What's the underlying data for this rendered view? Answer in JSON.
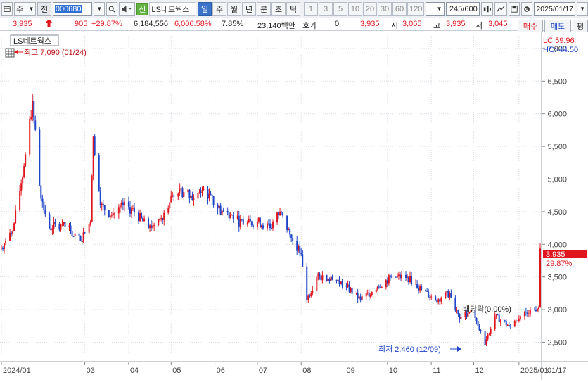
{
  "toolbar": {
    "market": "주",
    "scope": "전",
    "stock_code": "000680",
    "new_badge": "신",
    "stock_name": "LS네트웍스",
    "periods": [
      "일",
      "주",
      "월",
      "년",
      "분",
      "초",
      "틱"
    ],
    "active_period": "일",
    "numbers": [
      "1",
      "3",
      "5",
      "10",
      "20",
      "30",
      "60",
      "120"
    ],
    "count": "245/600",
    "date": "2025/01/17"
  },
  "info": {
    "price": "3,935",
    "change": "905",
    "change_pct": "+29.87%",
    "volume": "6,184,556",
    "volume_pct": "6,006.58%",
    "turnover": "7.85%",
    "amount": "23,140백만",
    "quote_label": "호가",
    "quote_value": "0",
    "quote_price": "3,935",
    "open_label": "시",
    "open": "3,065",
    "high_label": "고",
    "high": "3,935",
    "low_label": "저",
    "low": "3,045",
    "buy_label": "매수",
    "sell_label": "매도",
    "avg_label": "평"
  },
  "chart": {
    "legend_name": "LS네트웍스",
    "high_annotation": "최고 7,090 (01/24)",
    "low_annotation": "최저 2,460 (12/09)",
    "dividend_annotation": "배당락(0.00%)",
    "lc_label": "LC:59.96",
    "hc_label": "HC:-44.50",
    "current_price_tag": "3,935",
    "current_pct_tag": "29.87%",
    "y_ticks": [
      "7,000",
      "6,500",
      "6,000",
      "5,500",
      "5,000",
      "4,500",
      "4,000",
      "3,500",
      "3,000",
      "2,500"
    ],
    "x_ticks": [
      "2024/01",
      "03",
      "04",
      "05",
      "06",
      "07",
      "08",
      "09",
      "10",
      "11",
      "12",
      "2025/01"
    ],
    "x_right_label": "01/17",
    "colors": {
      "up": "#e0161f",
      "down": "#1e45c8",
      "grid": "#d9dde3",
      "tag_bg": "#e0161f"
    }
  },
  "chart_data": {
    "type": "candlestick",
    "y_range": [
      2300,
      7150
    ],
    "x_range": [
      "2024/01/02",
      "2025/01/17"
    ],
    "series": [
      {
        "name": "LS네트웍스",
        "points": [
          {
            "d": "2024/01/02",
            "c": 3950
          },
          {
            "d": "2024/01/10",
            "c": 4200
          },
          {
            "d": "2024/01/18",
            "c": 5200
          },
          {
            "d": "2024/01/24",
            "c": 6200
          },
          {
            "d": "2024/01/30",
            "c": 4700
          },
          {
            "d": "2024/02/05",
            "c": 4250
          },
          {
            "d": "2024/02/13",
            "c": 4300
          },
          {
            "d": "2024/02/20",
            "c": 4200
          },
          {
            "d": "2024/02/27",
            "c": 4050
          },
          {
            "d": "2024/03/05",
            "c": 4350
          },
          {
            "d": "2024/03/07",
            "c": 5650
          },
          {
            "d": "2024/03/12",
            "c": 4600
          },
          {
            "d": "2024/03/20",
            "c": 4450
          },
          {
            "d": "2024/03/28",
            "c": 4600
          },
          {
            "d": "2024/04/05",
            "c": 4500
          },
          {
            "d": "2024/04/15",
            "c": 4250
          },
          {
            "d": "2024/04/24",
            "c": 4400
          },
          {
            "d": "2024/05/02",
            "c": 4750
          },
          {
            "d": "2024/05/10",
            "c": 4800
          },
          {
            "d": "2024/05/17",
            "c": 4700
          },
          {
            "d": "2024/05/24",
            "c": 4850
          },
          {
            "d": "2024/06/03",
            "c": 4550
          },
          {
            "d": "2024/06/12",
            "c": 4450
          },
          {
            "d": "2024/06/21",
            "c": 4300
          },
          {
            "d": "2024/07/01",
            "c": 4350
          },
          {
            "d": "2024/07/10",
            "c": 4250
          },
          {
            "d": "2024/07/17",
            "c": 4500
          },
          {
            "d": "2024/07/25",
            "c": 4100
          },
          {
            "d": "2024/08/01",
            "c": 3850
          },
          {
            "d": "2024/08/05",
            "c": 3150
          },
          {
            "d": "2024/08/12",
            "c": 3500
          },
          {
            "d": "2024/08/22",
            "c": 3500
          },
          {
            "d": "2024/09/02",
            "c": 3350
          },
          {
            "d": "2024/09/12",
            "c": 3150
          },
          {
            "d": "2024/09/24",
            "c": 3350
          },
          {
            "d": "2024/10/04",
            "c": 3500
          },
          {
            "d": "2024/10/15",
            "c": 3500
          },
          {
            "d": "2024/10/25",
            "c": 3300
          },
          {
            "d": "2024/11/04",
            "c": 3150
          },
          {
            "d": "2024/11/14",
            "c": 3250
          },
          {
            "d": "2024/11/21",
            "c": 2850
          },
          {
            "d": "2024/11/29",
            "c": 3000
          },
          {
            "d": "2024/12/04",
            "c": 2750
          },
          {
            "d": "2024/12/09",
            "c": 2460
          },
          {
            "d": "2024/12/16",
            "c": 2900
          },
          {
            "d": "2024/12/26",
            "c": 2750
          },
          {
            "d": "2025/01/03",
            "c": 2900
          },
          {
            "d": "2025/01/10",
            "c": 3000
          },
          {
            "d": "2025/01/16",
            "c": 3030
          },
          {
            "d": "2025/01/17",
            "c": 3935
          }
        ]
      }
    ]
  }
}
